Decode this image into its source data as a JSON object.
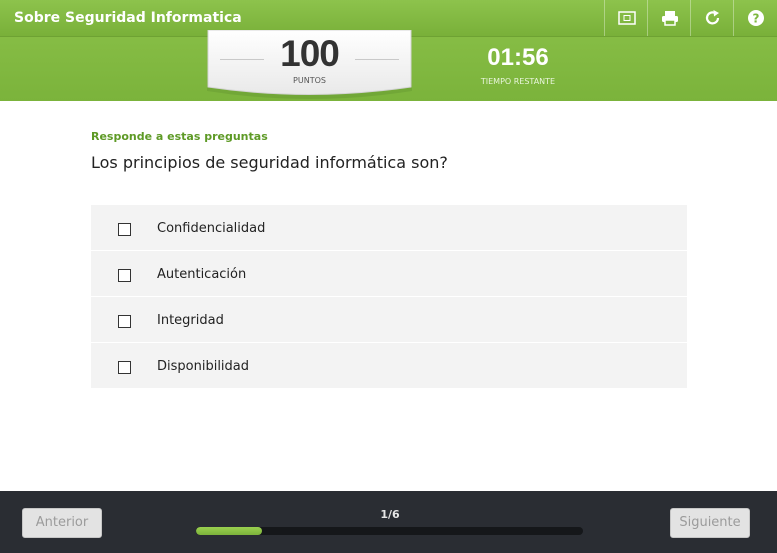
{
  "header": {
    "title": "Sobre Seguridad Informatica",
    "toolbar": [
      {
        "name": "fullscreen-icon"
      },
      {
        "name": "print-icon"
      },
      {
        "name": "restart-icon"
      },
      {
        "name": "help-icon"
      }
    ],
    "score": {
      "value": "100",
      "label": "PUNTOS"
    },
    "timer": {
      "value": "01:56",
      "label": "TIEMPO RESTANTE"
    }
  },
  "quiz": {
    "instruction": "Responde a estas preguntas",
    "question": "Los principios de seguridad informática son?",
    "options": [
      {
        "label": "Confidencialidad",
        "checked": false
      },
      {
        "label": "Autenticación",
        "checked": false
      },
      {
        "label": "Integridad",
        "checked": false
      },
      {
        "label": "Disponibilidad",
        "checked": false
      }
    ]
  },
  "footer": {
    "prev_label": "Anterior",
    "next_label": "Siguiente",
    "progress_text": "1/6",
    "progress_fraction": 0.17
  },
  "colors": {
    "accent": "#7db73e",
    "footer_bg": "#2a2d33",
    "instruction": "#5e9a26"
  }
}
